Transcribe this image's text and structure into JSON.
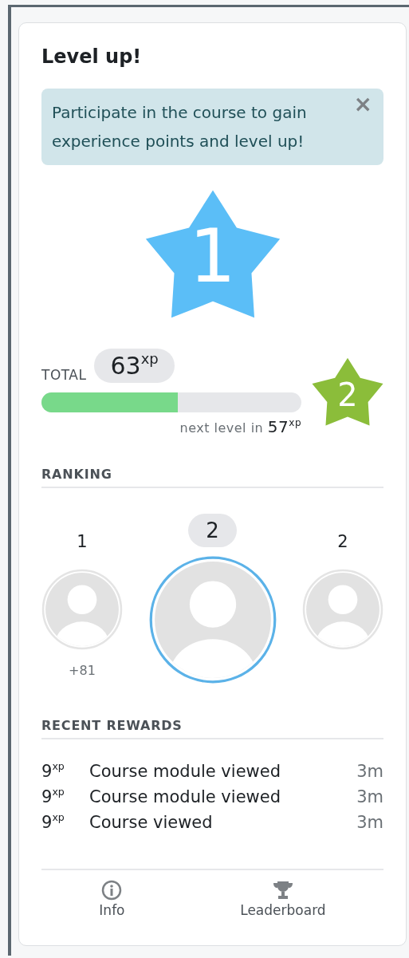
{
  "card": {
    "title": "Level up!"
  },
  "notice": {
    "text": "Participate in the course to gain experience points and level up!",
    "close": "×"
  },
  "level": {
    "current": "1"
  },
  "progress": {
    "total_label": "TOTAL",
    "total": "63$^{xp}$",
    "level": 0.525,
    "next_label": "next level in",
    "next_value": "57$^{xp}$",
    "next_level": "2"
  },
  "ranking": {
    "heading": "RANKING",
    "entries": [
      {
        "rank": "1",
        "selected": false,
        "note": "+81"
      },
      {
        "rank": "2",
        "selected": true
      },
      {
        "rank": "2",
        "selected": false
      }
    ]
  },
  "recent_rewards": {
    "heading": "RECENT REWARDS",
    "items": [
      {
        "points": "9$^{xp}$",
        "label": "Course module viewed",
        "time": "3m"
      },
      {
        "points": "9$^{xp}$",
        "label": "Course module viewed",
        "time": "3m"
      },
      {
        "points": "9$^{xp}$",
        "label": "Course viewed",
        "time": "3m"
      }
    ]
  },
  "footer": [
    {
      "kind": "info",
      "label": "Info"
    },
    {
      "kind": "trophy",
      "label": "Leaderboard"
    }
  ]
}
